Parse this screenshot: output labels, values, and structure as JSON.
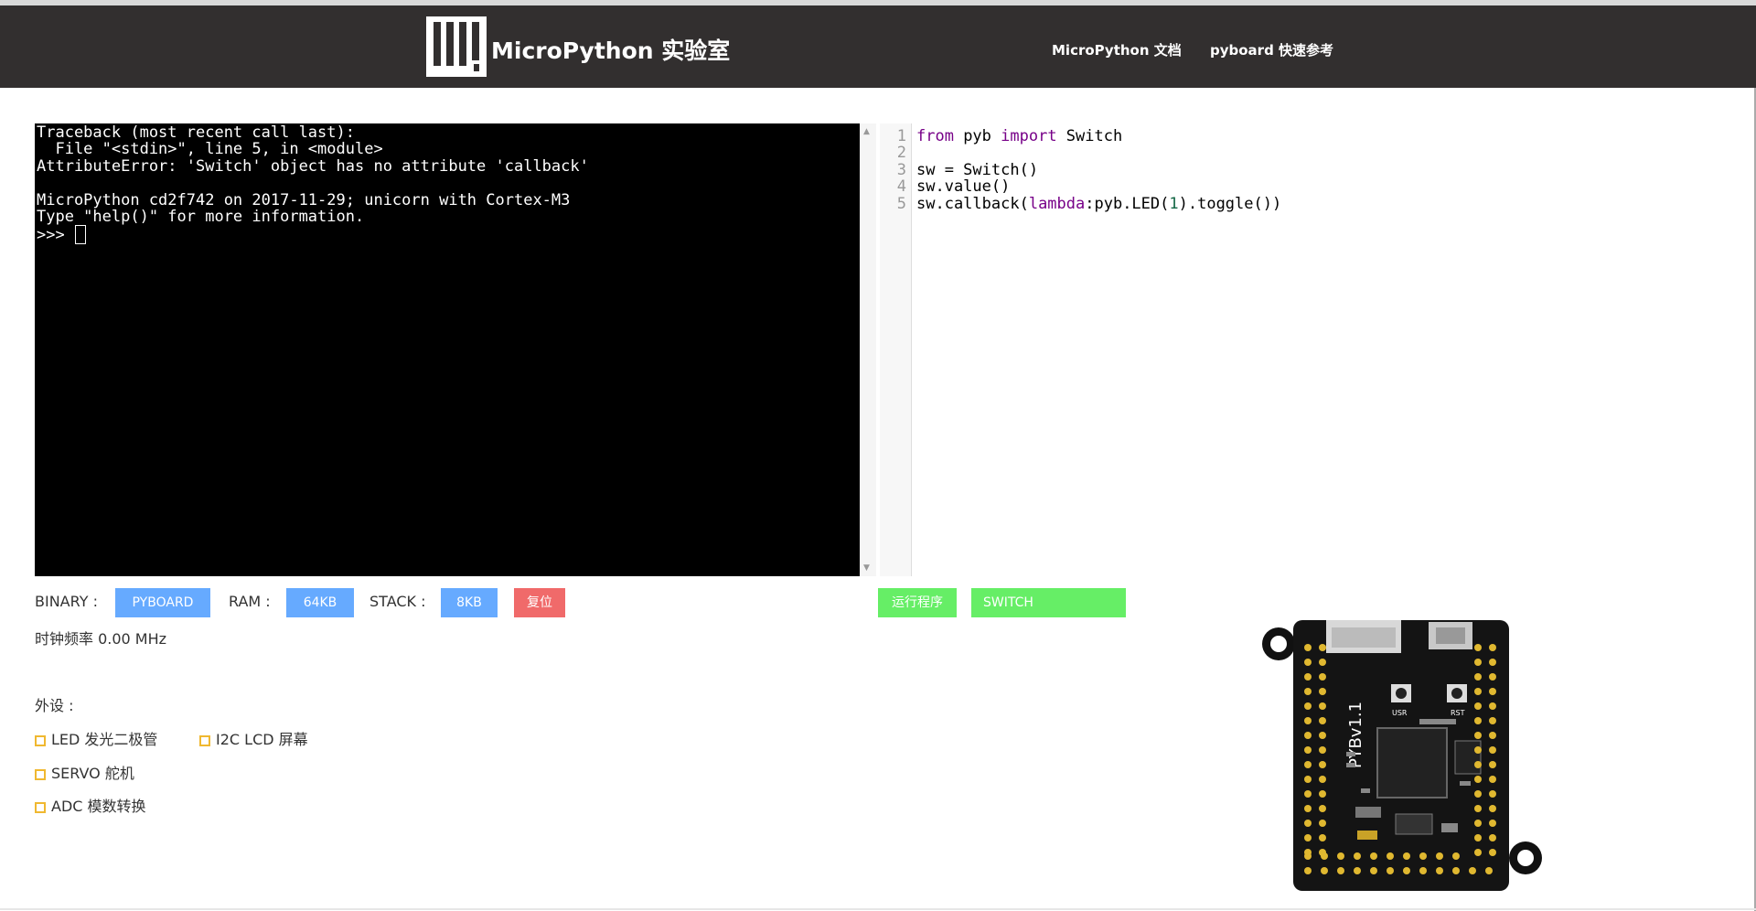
{
  "header": {
    "brand": "MicroPython 实验室",
    "nav": [
      {
        "label": "MicroPython 文档"
      },
      {
        "label": "pyboard 快速参考"
      }
    ]
  },
  "terminal": {
    "lines": [
      "Traceback (most recent call last):",
      "  File \"<stdin>\", line 5, in <module>",
      "AttributeError: 'Switch' object has no attribute 'callback'",
      "",
      "MicroPython cd2f742 on 2017-11-29; unicorn with Cortex-M3",
      "Type \"help()\" for more information."
    ],
    "prompt": ">>> "
  },
  "editor": {
    "line_numbers": [
      "1",
      "2",
      "3",
      "4",
      "5"
    ]
  },
  "controls": {
    "binary_label": "BINARY :",
    "binary_value": "PYBOARD",
    "ram_label": "RAM :",
    "ram_value": "64KB",
    "stack_label": "STACK :",
    "stack_value": "8KB",
    "reset_label": "复位",
    "run_label": "运行程序",
    "switch_label": "SWITCH",
    "clock_text": "时钟频率 0.00 MHz"
  },
  "peripherals": {
    "title": "外设 :",
    "items": [
      "LED 发光二极管",
      "I2C LCD 屏幕",
      "SERVO 舵机",
      "ADC 模数转换"
    ]
  },
  "board": {
    "model_text": "PYBv1.1",
    "usr_label": "USR",
    "rst_label": "RST"
  },
  "colors": {
    "header_bg": "#322f2f",
    "btn_blue": "#66aaff",
    "btn_red": "#f06a6a",
    "btn_green": "#66ee66",
    "checkbox_border": "#f0b830",
    "keyword": "#770088",
    "number": "#116644"
  }
}
